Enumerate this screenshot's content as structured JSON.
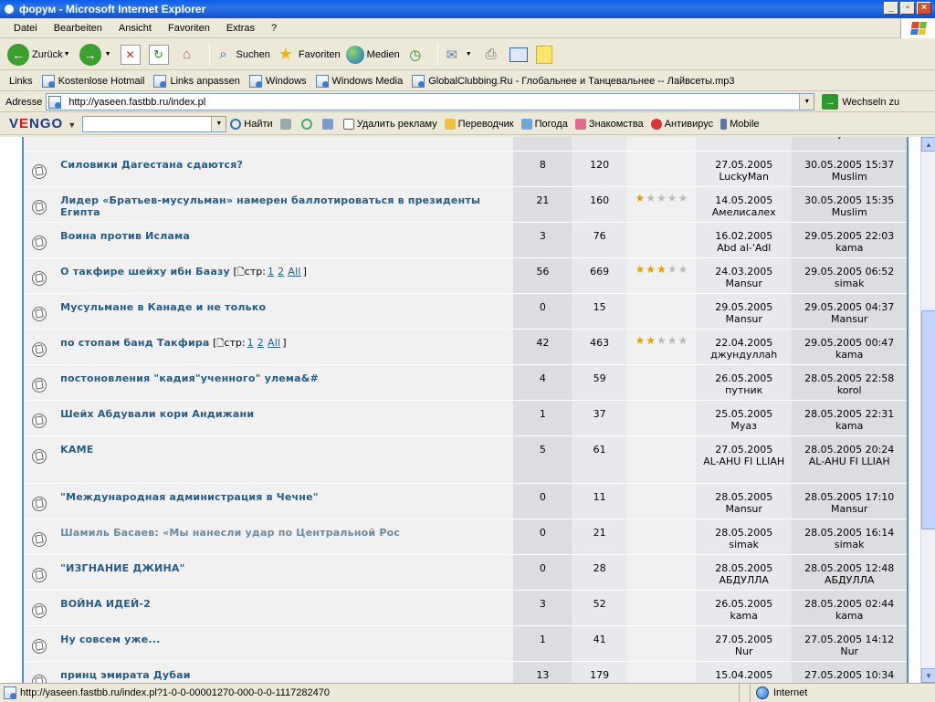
{
  "window": {
    "title": "форум - Microsoft Internet Explorer"
  },
  "menu": [
    "Datei",
    "Bearbeiten",
    "Ansicht",
    "Favoriten",
    "Extras",
    "?"
  ],
  "toolbar": {
    "back": "Zurück",
    "search": "Suchen",
    "favorites": "Favoriten",
    "media": "Medien"
  },
  "links": {
    "label": "Links",
    "items": [
      "Kostenlose Hotmail",
      "Links anpassen",
      "Windows",
      "Windows Media",
      "GlobalClubbing.Ru - Глобальнее и Танцевальнее -- Лайвсеты.mp3"
    ]
  },
  "address": {
    "label": "Adresse",
    "url": "http://yaseen.fastbb.ru/index.pl",
    "go": "Wechseln zu"
  },
  "vengo": {
    "logo_a": "V",
    "logo_e": "E",
    "logo_rest": "NGO",
    "find": "Найти",
    "items": [
      "Удалить рекламу",
      "Переводчик",
      "Погода",
      "Знакомства",
      "Антивирус",
      "Mobile"
    ]
  },
  "topics": [
    {
      "title": "",
      "replies": "",
      "views": "",
      "rating": 0,
      "started": "",
      "starter": "Mansur",
      "last_date": "",
      "last_user": "путник",
      "partial": true
    },
    {
      "title": "Силовики Дагестана сдаются?",
      "replies": "8",
      "views": "120",
      "rating": 0,
      "started": "27.05.2005",
      "starter": "LuckyMan",
      "last_date": "30.05.2005 15:37",
      "last_user": "Muslim"
    },
    {
      "title": "Лидер «Братьев-мусульман» намерен баллотироваться в президенты Египта",
      "replies": "21",
      "views": "160",
      "rating": 1,
      "started": "14.05.2005",
      "starter": "Амелисалех",
      "last_date": "30.05.2005 15:35",
      "last_user": "Muslim"
    },
    {
      "title": "Воина против Ислама",
      "replies": "3",
      "views": "76",
      "rating": 0,
      "started": "16.02.2005",
      "starter": "Abd al-'Adl",
      "last_date": "29.05.2005 22:03",
      "last_user": "kama"
    },
    {
      "title": "О такфире шейху ибн Баазу",
      "pages_prefix": "[",
      "pages_label": "стр:",
      "pages": [
        "1",
        "2",
        "All"
      ],
      "pages_suffix": "]",
      "replies": "56",
      "views": "669",
      "rating": 3,
      "started": "24.03.2005",
      "starter": "Mansur",
      "last_date": "29.05.2005 06:52",
      "last_user": "simak"
    },
    {
      "title": "Мусульмане в Канаде и не только",
      "replies": "0",
      "views": "15",
      "rating": 0,
      "started": "29.05.2005",
      "starter": "Mansur",
      "last_date": "29.05.2005 04:37",
      "last_user": "Mansur"
    },
    {
      "title": "по стопам банд Такфира",
      "pages_prefix": "[",
      "pages_label": "стр:",
      "pages": [
        "1",
        "2",
        "All"
      ],
      "pages_suffix": "]",
      "replies": "42",
      "views": "463",
      "rating": 2,
      "started": "22.04.2005",
      "starter": "джундуллаh",
      "last_date": "29.05.2005 00:47",
      "last_user": "kama"
    },
    {
      "title": "постоновления \"кадия\"ученного\" улема&#",
      "replies": "4",
      "views": "59",
      "rating": 0,
      "started": "26.05.2005",
      "starter": "путник",
      "last_date": "28.05.2005 22:58",
      "last_user": "korol"
    },
    {
      "title": "Шейх Абдували кори Андижани",
      "replies": "1",
      "views": "37",
      "rating": 0,
      "started": "25.05.2005",
      "starter": "Муаз",
      "last_date": "28.05.2005 22:31",
      "last_user": "kama"
    },
    {
      "title": "KAME",
      "replies": "5",
      "views": "61",
      "rating": 0,
      "started": "27.05.2005",
      "starter": "AL-AHU FI LLIAH",
      "last_date": "28.05.2005 20:24",
      "last_user": "AL-AHU FI LLIAH",
      "tall": true
    },
    {
      "title": "\"Международная администрация в Чечне\"",
      "replies": "0",
      "views": "11",
      "rating": 0,
      "started": "28.05.2005",
      "starter": "Mansur",
      "last_date": "28.05.2005 17:10",
      "last_user": "Mansur"
    },
    {
      "title": "Шамиль Басаев: «Мы нанесли удар по Центральной Рос",
      "replies": "0",
      "views": "21",
      "rating": 0,
      "started": "28.05.2005",
      "starter": "simak",
      "last_date": "28.05.2005 16:14",
      "last_user": "simak",
      "visited": true
    },
    {
      "title": "\"ИЗГНАНИЕ ДЖИНА\"",
      "replies": "0",
      "views": "28",
      "rating": 0,
      "started": "28.05.2005",
      "starter": "АБДУЛЛА",
      "last_date": "28.05.2005 12:48",
      "last_user": "АБДУЛЛА"
    },
    {
      "title": "ВОЙНА ИДЕЙ-2",
      "replies": "3",
      "views": "52",
      "rating": 0,
      "started": "26.05.2005",
      "starter": "kama",
      "last_date": "28.05.2005 02:44",
      "last_user": "kama"
    },
    {
      "title": "Ну совсем уже...",
      "replies": "1",
      "views": "41",
      "rating": 0,
      "started": "27.05.2005",
      "starter": "Nur",
      "last_date": "27.05.2005 14:12",
      "last_user": "Nur"
    },
    {
      "title": "принц эмирата Дубаи",
      "replies": "13",
      "views": "179",
      "rating": 0,
      "started": "15.04.2005",
      "starter": "",
      "last_date": "27.05.2005 10:34",
      "last_user": ""
    }
  ],
  "status": {
    "url": "http://yaseen.fastbb.ru/index.pl?1-0-0-00001270-000-0-0-1117282470",
    "zone": "Internet"
  }
}
